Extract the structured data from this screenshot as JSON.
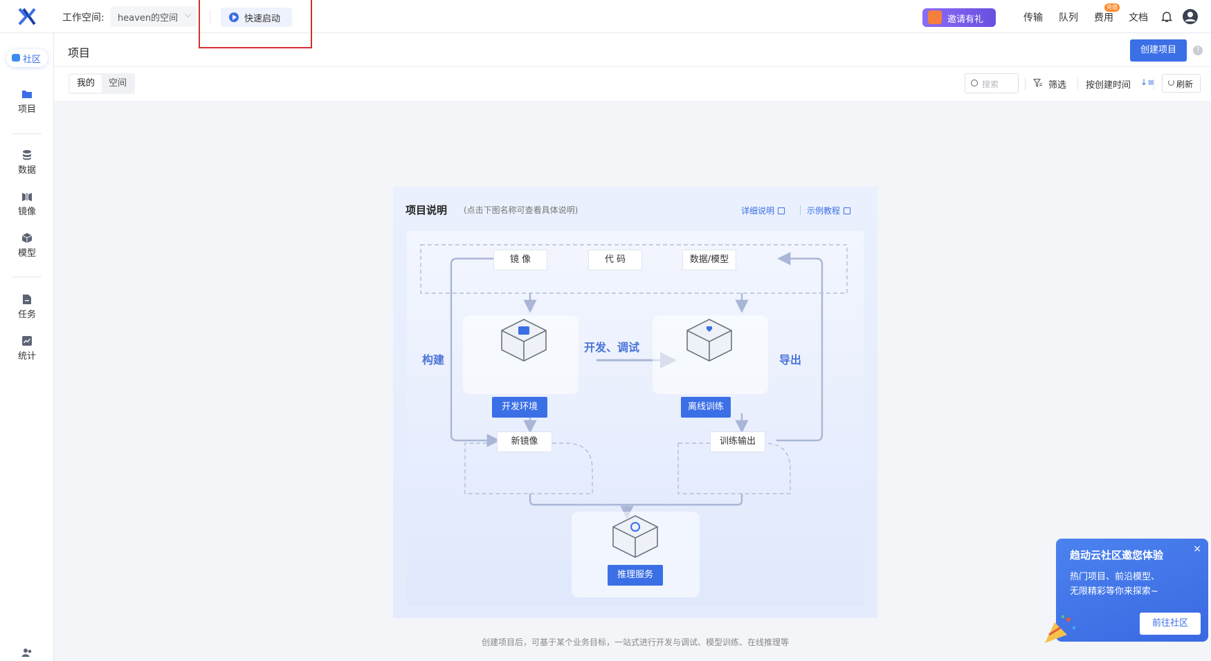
{
  "header": {
    "workspace_label": "工作空间:",
    "workspace_value": "heaven的空间",
    "quick_start": "快速启动",
    "invite": "邀请有礼",
    "nav": [
      "传输",
      "队列",
      "费用",
      "文档"
    ],
    "fee_badge": "充值"
  },
  "sidebar": {
    "community": "社区",
    "items": [
      {
        "label": "项目",
        "icon": "folder-icon"
      },
      {
        "label": "数据",
        "icon": "database-icon"
      },
      {
        "label": "镜像",
        "icon": "mirror-icon"
      },
      {
        "label": "模型",
        "icon": "cube-icon"
      },
      {
        "label": "任务",
        "icon": "file-icon"
      },
      {
        "label": "统计",
        "icon": "chart-icon"
      }
    ]
  },
  "page": {
    "title": "项目",
    "create_button": "创建项目",
    "tabs": [
      "我的",
      "空间"
    ],
    "search_placeholder": "搜索",
    "filter": "筛选",
    "sort": "按创建时间",
    "refresh": "刷新"
  },
  "diagram": {
    "title": "项目说明",
    "subtitle": "(点击下图名称可查看具体说明)",
    "link_detail": "详细说明",
    "link_example": "示例教程",
    "node_mirror": "镜 像",
    "node_code": "代 码",
    "node_data": "数据/模型",
    "label_dev_debug": "开发、调试",
    "label_build": "构建",
    "label_export": "导出",
    "tag_dev_env": "开发环境",
    "tag_offline_train": "离线训练",
    "node_new_mirror": "新镜像",
    "node_train_output": "训练输出",
    "tag_inference": "推理服务"
  },
  "caption": "创建项目后，可基于某个业务目标，一站式进行开发与调试、模型训练、在线推理等",
  "popup": {
    "title": "趋动云社区邀您体验",
    "line1": "热门项目、前沿模型、",
    "line2": "无限精彩等你来探索~",
    "button": "前往社区",
    "close": "×"
  },
  "colors": {
    "accent": "#3b6fe6",
    "highlight_box": "#d62d2d",
    "invite_gradient": "#7b5cf0"
  }
}
